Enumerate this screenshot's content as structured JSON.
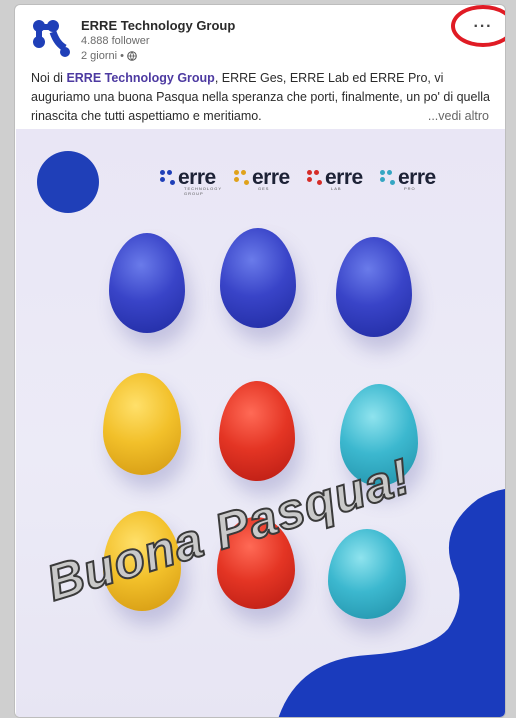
{
  "post": {
    "author": "ERRE Technology Group",
    "followers": "4.888 follower",
    "age": "2 giorni •",
    "menu_label": "···",
    "text_mention": "ERRE Technology Group",
    "text_intro": "Noi di ",
    "text_rest": ", ERRE Ges, ERRE Lab ed ERRE Pro, vi auguriamo una buona Pasqua nella speranza che porti, finalmente, un po' di quella rinascita che tutti aspettiamo e meritiamo.",
    "see_more": "...vedi altro"
  },
  "image": {
    "greeting": "Buona Pasqua!",
    "brands": [
      {
        "word": "erre",
        "sub": "TECHNOLOGY GROUP",
        "color": "#1f3fb8"
      },
      {
        "word": "erre",
        "sub": "GES",
        "color": "#e0a21b"
      },
      {
        "word": "erre",
        "sub": "LAB",
        "color": "#d62c28"
      },
      {
        "word": "erre",
        "sub": "PRO",
        "color": "#35a6c3"
      }
    ]
  },
  "icons": [
    "erre-logo-icon",
    "globe-icon",
    "more-options-icon"
  ],
  "colors": {
    "accent": "#1f3fb8",
    "highlight_ring": "#e01b24",
    "mention": "#4d3aa1"
  }
}
